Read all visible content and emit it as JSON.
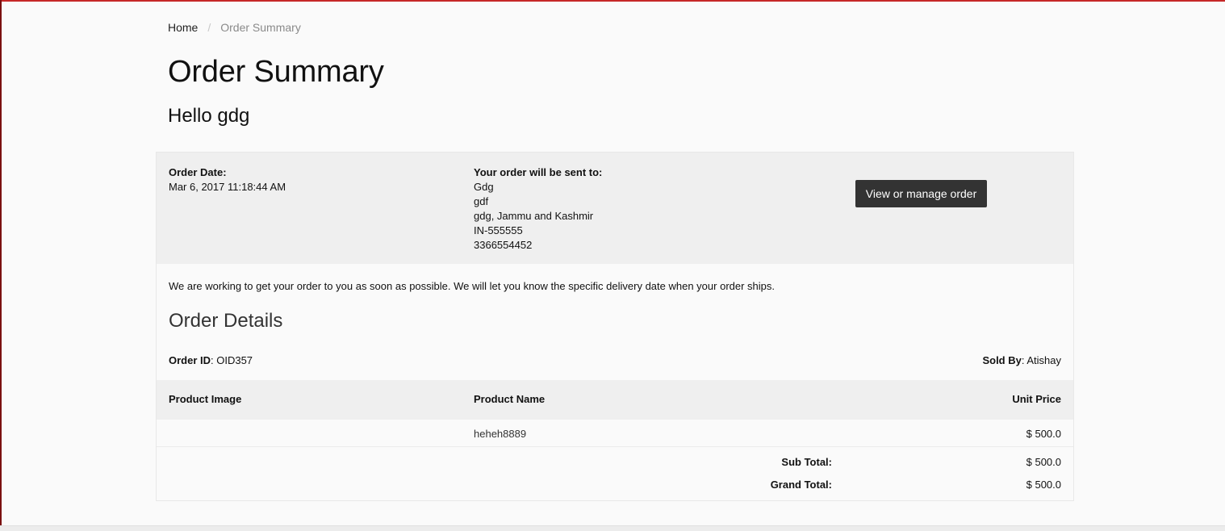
{
  "breadcrumb": {
    "home": "Home",
    "separator": "/",
    "current": "Order Summary"
  },
  "page": {
    "title": "Order Summary",
    "greeting": "Hello gdg"
  },
  "order_info": {
    "date_label": "Order Date:",
    "date_value": "Mar 6, 2017 11:18:44 AM",
    "ship_label": "Your order will be sent to:",
    "ship_lines": [
      "Gdg",
      "gdf",
      "gdg, Jammu and Kashmir",
      "IN-555555",
      "3366554452"
    ],
    "manage_button": "View or manage order"
  },
  "delivery_message": "We are working to get your order to you as soon as possible. We will let you know the specific delivery date when your order ships.",
  "details": {
    "title": "Order Details",
    "order_id_label": "Order ID",
    "order_id_value": ": OID357",
    "sold_by_label": "Sold By",
    "sold_by_value": ": Atishay"
  },
  "table": {
    "headers": {
      "image": "Product Image",
      "name": "Product Name",
      "price": "Unit Price"
    },
    "rows": [
      {
        "image": "",
        "name": "heheh8889",
        "price": "$ 500.0"
      }
    ]
  },
  "totals": {
    "sub_label": "Sub Total:",
    "sub_value": "$ 500.0",
    "grand_label": "Grand Total:",
    "grand_value": "$ 500.0"
  },
  "colors": {
    "accent_border": "#c62828",
    "button_bg": "#333333",
    "panel_bg": "#efefef"
  }
}
